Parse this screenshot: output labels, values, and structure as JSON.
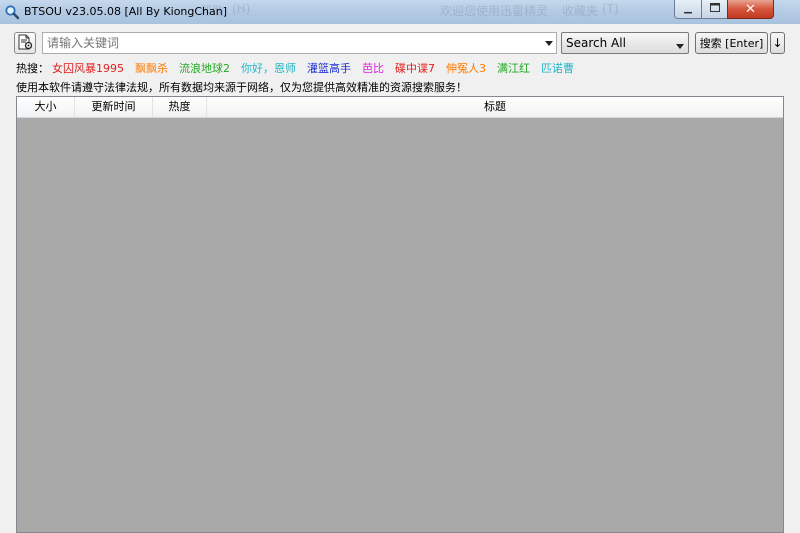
{
  "window": {
    "title": "BTSOU v23.05.08 [All By KiongChan]",
    "background_text": [
      "收藏夹",
      "(T)",
      "帮助",
      "(H)",
      "欢迎您使用迅雷精灵"
    ]
  },
  "search": {
    "placeholder": "请输入关键词",
    "engine": "Search All",
    "go_label": "搜索 [Enter]",
    "sort_label": "↓"
  },
  "hot": {
    "label": "热搜：",
    "items": [
      {
        "text": "女囚风暴1995",
        "color": "#e02020"
      },
      {
        "text": "飘飘杀",
        "color": "#ff7a00"
      },
      {
        "text": "流浪地球2",
        "color": "#22aa22"
      },
      {
        "text": "你好，恩师",
        "color": "#1fb6c6"
      },
      {
        "text": "灌篮高手",
        "color": "#1a2ad0"
      },
      {
        "text": "芭比",
        "color": "#e020e0"
      },
      {
        "text": "碟中谍7",
        "color": "#e02020"
      },
      {
        "text": "伸冤人3",
        "color": "#ff7a00"
      },
      {
        "text": "满江红",
        "color": "#22aa22"
      },
      {
        "text": "匹诺曹",
        "color": "#1fb6c6"
      }
    ]
  },
  "notice": "使用本软件请遵守法律法规，所有数据均来源于网络，仅为您提供高效精准的资源搜索服务！",
  "columns": [
    "大小",
    "更新时间",
    "热度",
    "标题"
  ],
  "colors": {
    "list_background": "#a9a9a9",
    "close_button": "#c94a32",
    "titlebar": "#b4cbe4"
  },
  "icons": {
    "app": "magnifier-icon",
    "search_button": "document-gear-icon"
  }
}
